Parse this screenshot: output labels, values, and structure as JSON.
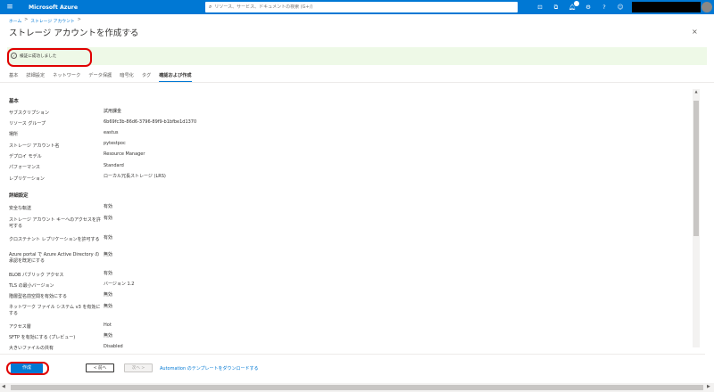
{
  "topbar": {
    "menu_icon": "hamburger-icon",
    "brand": "Microsoft Azure",
    "search_placeholder": "リソース、サービス、ドキュメントの検索 (G+/)"
  },
  "breadcrumb": {
    "items": [
      "ホーム",
      "ストレージ アカウント"
    ],
    "separator": ">"
  },
  "page": {
    "title": "ストレージ アカウントを作成する",
    "more": "…",
    "close": "×"
  },
  "banner": {
    "text": "検証に成功しました",
    "accent": "#eef9e7"
  },
  "tabs": [
    {
      "label": "基本",
      "active": false
    },
    {
      "label": "詳細設定",
      "active": false
    },
    {
      "label": "ネットワーク",
      "active": false
    },
    {
      "label": "データ保護",
      "active": false
    },
    {
      "label": "暗号化",
      "active": false
    },
    {
      "label": "タグ",
      "active": false
    },
    {
      "label": "確認および作成",
      "active": true
    }
  ],
  "sections": {
    "basic": {
      "header": "基本",
      "rows": [
        {
          "label": "サブスクリプション",
          "value": "試用課金"
        },
        {
          "label": "リソース グループ",
          "value": "6b69fc3b-86d6-3796-89f9-b1bfbe1d1370"
        },
        {
          "label": "場所",
          "value": "eastus"
        },
        {
          "label": "ストレージ アカウント名",
          "value": "pytestpoc"
        },
        {
          "label": "デプロイ モデル",
          "value": "Resource Manager"
        },
        {
          "label": "パフォーマンス",
          "value": "Standard"
        },
        {
          "label": "レプリケーション",
          "value": "ローカル冗長ストレージ (LRS)"
        }
      ]
    },
    "advanced": {
      "header": "詳細設定",
      "rows": [
        {
          "label": "安全な転送",
          "value": "有効"
        },
        {
          "label": "ストレージ アカウント キーへのアクセスを許可する",
          "value": "有効"
        },
        {
          "label": "クロステナント レプリケーションを許可する",
          "value": "有効"
        },
        {
          "label": "Azure portal で Azure Active Directory の承認を既定にする",
          "value": "無効"
        },
        {
          "label": "BLOB パブリック アクセス",
          "value": "有効"
        },
        {
          "label": "TLS の最小バージョン",
          "value": "バージョン 1.2"
        },
        {
          "label": "階層型名前空間を有効にする",
          "value": "無効"
        },
        {
          "label": "ネットワーク ファイル システム v3 を有効にする",
          "value": "無効"
        },
        {
          "label": "アクセス層",
          "value": "Hot"
        },
        {
          "label": "SFTP を有効にする (プレビュー)",
          "value": "無効"
        },
        {
          "label": "大きいファイルの共有",
          "value": "Disabled"
        }
      ]
    }
  },
  "footer": {
    "create_label": "作成",
    "prev_label": "< 前へ",
    "next_label": "次へ >",
    "download_link": "Automation のテンプレートをダウンロードする"
  },
  "colors": {
    "brand": "#0078d4",
    "highlight": "#e00000"
  }
}
